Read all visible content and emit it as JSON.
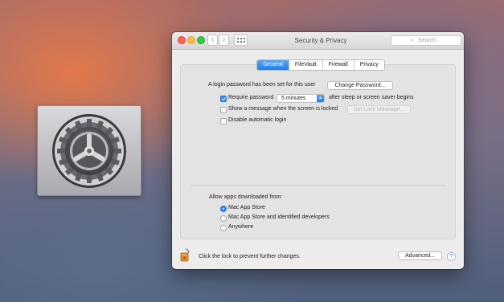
{
  "window": {
    "title": "Security & Privacy",
    "search_placeholder": "Search"
  },
  "tabs": [
    {
      "label": "General",
      "active": true
    },
    {
      "label": "FileVault",
      "active": false
    },
    {
      "label": "Firewall",
      "active": false
    },
    {
      "label": "Privacy",
      "active": false
    }
  ],
  "general": {
    "login_password_text": "A login password has been set for this user",
    "change_password_label": "Change Password...",
    "require_password": {
      "label": "Require password",
      "checked": true,
      "value": "5 minutes",
      "suffix": "after sleep or screen saver begins"
    },
    "show_message": {
      "label": "Show a message when the screen is locked",
      "checked": false,
      "button_label": "Set Lock Message..."
    },
    "disable_auto_login": {
      "label": "Disable automatic login",
      "checked": false
    }
  },
  "downloads": {
    "heading": "Allow apps downloaded from:",
    "options": [
      {
        "label": "Mac App Store",
        "selected": true
      },
      {
        "label": "Mac App Store and identified developers",
        "selected": false
      },
      {
        "label": "Anywhere",
        "selected": false
      }
    ]
  },
  "footer": {
    "lock_text": "Click the lock to prevent further changes.",
    "advanced_label": "Advanced...",
    "help_label": "?"
  },
  "colors": {
    "accent": "#2f86f6",
    "close": "#fc605b",
    "minimize": "#fdbc40",
    "zoom": "#34c84a"
  },
  "icons": {
    "app_icon": "gear-icon",
    "lock": "unlocked-padlock-icon",
    "search": "search-icon"
  }
}
